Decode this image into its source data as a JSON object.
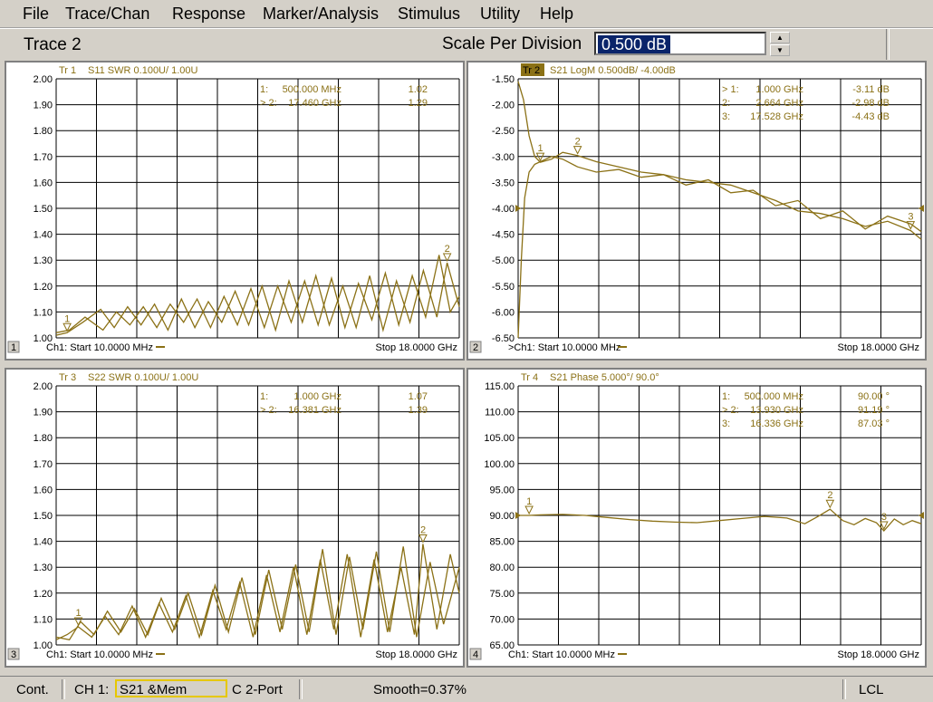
{
  "menu": [
    "File",
    "Trace/Chan",
    "Response",
    "Marker/Analysis",
    "Stimulus",
    "Utility",
    "Help"
  ],
  "toolbar": {
    "active_trace": "Trace 2",
    "scale_label": "Scale Per Division",
    "scale_value": "0.500 dB",
    "spin_up": "▲",
    "spin_down": "▼"
  },
  "colors": {
    "trace": "#8b7116",
    "grid": "#000000",
    "background": "#ffffff",
    "active_header_bg": "#8b7116"
  },
  "status": {
    "mode": "Cont.",
    "channel": "CH 1:",
    "trace_box": "S21 &Mem",
    "cal": "C  2-Port",
    "smooth": "Smooth=0.37%",
    "remote": "LCL"
  },
  "panels": [
    {
      "index": "1",
      "tr_label": "Tr  1",
      "header": "S11 SWR 0.100U/  1.00U",
      "active": false,
      "y_ticks": [
        "2.00",
        "1.90",
        "1.80",
        "1.70",
        "1.60",
        "1.50",
        "1.40",
        "1.30",
        "1.20",
        "1.10",
        "1.00"
      ],
      "start_label": "Ch1: Start  10.0000 MHz",
      "stop_label": "Stop  18.0000 GHz",
      "markers_table": [
        {
          "num": "1:",
          "freq": "500.000 MHz",
          "val": "1.02",
          "active": false
        },
        {
          "num": "> 2:",
          "freq": "17.460 GHz",
          "val": "1.29",
          "active": true
        }
      ]
    },
    {
      "index": "2",
      "tr_label": "Tr  2",
      "header": "S21 LogM 0.500dB/  -4.00dB",
      "active": true,
      "y_ticks": [
        "-1.50",
        "-2.00",
        "-2.50",
        "-3.00",
        "-3.50",
        "-4.00",
        "-4.50",
        "-5.00",
        "-5.50",
        "-6.00",
        "-6.50"
      ],
      "start_label": ">Ch1: Start  10.0000 MHz",
      "stop_label": "Stop  18.0000 GHz",
      "markers_table": [
        {
          "num": "> 1:",
          "freq": "1.000 GHz",
          "val": "-3.11 dB",
          "active": true
        },
        {
          "num": "2:",
          "freq": "2.664 GHz",
          "val": "-2.98 dB",
          "active": false
        },
        {
          "num": "3:",
          "freq": "17.528 GHz",
          "val": "-4.43 dB",
          "active": false
        }
      ]
    },
    {
      "index": "3",
      "tr_label": "Tr  3",
      "header": "S22 SWR 0.100U/  1.00U",
      "active": false,
      "y_ticks": [
        "2.00",
        "1.90",
        "1.80",
        "1.70",
        "1.60",
        "1.50",
        "1.40",
        "1.30",
        "1.20",
        "1.10",
        "1.00"
      ],
      "start_label": "Ch1: Start  10.0000 MHz",
      "stop_label": "Stop  18.0000 GHz",
      "markers_table": [
        {
          "num": "1:",
          "freq": "1.000 GHz",
          "val": "1.07",
          "active": false
        },
        {
          "num": "> 2:",
          "freq": "16.381 GHz",
          "val": "1.39",
          "active": true
        }
      ]
    },
    {
      "index": "4",
      "tr_label": "Tr  4",
      "header": "S21 Phase 5.000°/  90.0°",
      "active": false,
      "y_ticks": [
        "115.00",
        "110.00",
        "105.00",
        "100.00",
        "95.00",
        "90.00",
        "85.00",
        "80.00",
        "75.00",
        "70.00",
        "65.00"
      ],
      "start_label": "Ch1: Start  10.0000 MHz",
      "stop_label": "Stop  18.0000 GHz",
      "markers_table": [
        {
          "num": "1:",
          "freq": "500.000 MHz",
          "val": "90.00 °",
          "active": false
        },
        {
          "num": "> 2:",
          "freq": "13.930 GHz",
          "val": "91.19 °",
          "active": true
        },
        {
          "num": "3:",
          "freq": "16.336 GHz",
          "val": "87.03 °",
          "active": false
        }
      ]
    }
  ],
  "chart_data": [
    {
      "type": "line",
      "title": "S11 SWR 0.100U/  1.00U",
      "xlabel": "",
      "ylabel": "",
      "xlim_ghz": [
        0.01,
        18.0
      ],
      "ylim": [
        1.0,
        2.0
      ],
      "grid": true,
      "series": [
        {
          "x": [
            0.01,
            0.5,
            1.2,
            2.0,
            2.6,
            3.2,
            3.8,
            4.4,
            5.0,
            5.6,
            6.2,
            6.8,
            7.4,
            8.0,
            8.6,
            9.2,
            9.8,
            10.4,
            11.0,
            11.6,
            12.2,
            12.8,
            13.4,
            14.0,
            14.6,
            15.2,
            15.8,
            16.4,
            17.0,
            17.46,
            18.0
          ],
          "y": [
            1.01,
            1.02,
            1.06,
            1.11,
            1.04,
            1.12,
            1.05,
            1.13,
            1.03,
            1.15,
            1.04,
            1.14,
            1.06,
            1.18,
            1.05,
            1.2,
            1.03,
            1.22,
            1.06,
            1.24,
            1.05,
            1.2,
            1.04,
            1.24,
            1.03,
            1.22,
            1.06,
            1.26,
            1.08,
            1.29,
            1.12
          ]
        },
        {
          "x": [
            0.01,
            0.6,
            1.3,
            2.1,
            2.7,
            3.3,
            3.9,
            4.5,
            5.1,
            5.7,
            6.3,
            6.9,
            7.5,
            8.1,
            8.7,
            9.3,
            9.9,
            10.5,
            11.1,
            11.7,
            12.3,
            12.9,
            13.5,
            14.1,
            14.7,
            15.3,
            15.9,
            16.5,
            17.1,
            17.6,
            18.0
          ],
          "y": [
            1.02,
            1.03,
            1.08,
            1.03,
            1.1,
            1.05,
            1.12,
            1.04,
            1.13,
            1.06,
            1.15,
            1.04,
            1.16,
            1.05,
            1.19,
            1.04,
            1.2,
            1.06,
            1.22,
            1.05,
            1.23,
            1.04,
            1.21,
            1.07,
            1.25,
            1.05,
            1.24,
            1.08,
            1.32,
            1.1,
            1.16
          ]
        }
      ],
      "markers": [
        {
          "label": "1",
          "x": 0.5,
          "y": 1.02
        },
        {
          "label": "2",
          "x": 17.46,
          "y": 1.29
        }
      ]
    },
    {
      "type": "line",
      "title": "S21 LogM 0.500dB/  -4.00dB",
      "xlabel": "",
      "ylabel": "",
      "xlim_ghz": [
        0.01,
        18.0
      ],
      "ylim": [
        -6.5,
        -1.5
      ],
      "reference_level": -4.0,
      "grid": true,
      "series": [
        {
          "x": [
            0.01,
            0.25,
            0.5,
            0.75,
            1.0,
            1.5,
            2.0,
            2.66,
            3.5,
            4.5,
            5.5,
            6.5,
            7.5,
            8.5,
            9.5,
            10.5,
            11.5,
            12.5,
            13.5,
            14.5,
            15.5,
            16.5,
            17.53,
            18.0
          ],
          "y": [
            -1.55,
            -1.9,
            -2.6,
            -3.0,
            -3.11,
            -3.05,
            -2.92,
            -2.98,
            -3.1,
            -3.2,
            -3.3,
            -3.35,
            -3.45,
            -3.5,
            -3.55,
            -3.7,
            -3.85,
            -4.05,
            -4.1,
            -4.2,
            -4.35,
            -4.25,
            -4.43,
            -4.6
          ]
        },
        {
          "x": [
            0.01,
            0.15,
            0.3,
            0.5,
            0.75,
            1.0,
            1.5,
            2.0,
            2.66,
            3.5,
            4.5,
            5.5,
            6.5,
            7.5,
            8.5,
            9.5,
            10.5,
            11.5,
            12.5,
            13.5,
            14.5,
            15.5,
            16.5,
            17.53,
            18.0
          ],
          "y": [
            -6.5,
            -5.0,
            -3.8,
            -3.3,
            -3.15,
            -3.1,
            -3.0,
            -3.05,
            -3.2,
            -3.3,
            -3.25,
            -3.4,
            -3.35,
            -3.55,
            -3.45,
            -3.7,
            -3.65,
            -3.95,
            -3.85,
            -4.2,
            -4.05,
            -4.4,
            -4.15,
            -4.3,
            -4.45
          ]
        }
      ],
      "markers": [
        {
          "label": "1",
          "x": 1.0,
          "y": -3.11
        },
        {
          "label": "2",
          "x": 2.664,
          "y": -2.98
        },
        {
          "label": "3",
          "x": 17.528,
          "y": -4.43
        }
      ]
    },
    {
      "type": "line",
      "title": "S22 SWR 0.100U/  1.00U",
      "xlabel": "",
      "ylabel": "",
      "xlim_ghz": [
        0.01,
        18.0
      ],
      "ylim": [
        1.0,
        2.0
      ],
      "grid": true,
      "series": [
        {
          "x": [
            0.01,
            0.5,
            1.0,
            1.6,
            2.2,
            2.8,
            3.4,
            4.0,
            4.6,
            5.2,
            5.8,
            6.4,
            7.0,
            7.6,
            8.2,
            8.8,
            9.4,
            10.0,
            10.6,
            11.2,
            11.8,
            12.4,
            13.0,
            13.6,
            14.2,
            14.8,
            15.4,
            16.0,
            16.38,
            17.0,
            17.6,
            18.0
          ],
          "y": [
            1.02,
            1.04,
            1.07,
            1.03,
            1.11,
            1.04,
            1.15,
            1.03,
            1.16,
            1.05,
            1.19,
            1.03,
            1.21,
            1.06,
            1.24,
            1.03,
            1.27,
            1.05,
            1.3,
            1.04,
            1.33,
            1.06,
            1.35,
            1.03,
            1.33,
            1.05,
            1.3,
            1.04,
            1.39,
            1.06,
            1.35,
            1.2
          ]
        },
        {
          "x": [
            0.01,
            0.6,
            1.1,
            1.7,
            2.3,
            2.9,
            3.5,
            4.1,
            4.7,
            5.3,
            5.9,
            6.5,
            7.1,
            7.7,
            8.3,
            8.9,
            9.5,
            10.1,
            10.7,
            11.3,
            11.9,
            12.5,
            13.1,
            13.7,
            14.3,
            14.9,
            15.5,
            16.1,
            16.7,
            17.3,
            18.0
          ],
          "y": [
            1.03,
            1.02,
            1.09,
            1.04,
            1.13,
            1.05,
            1.14,
            1.04,
            1.18,
            1.06,
            1.2,
            1.04,
            1.23,
            1.05,
            1.26,
            1.04,
            1.29,
            1.06,
            1.31,
            1.05,
            1.37,
            1.04,
            1.34,
            1.06,
            1.36,
            1.05,
            1.38,
            1.03,
            1.32,
            1.08,
            1.3
          ]
        }
      ],
      "markers": [
        {
          "label": "1",
          "x": 1.0,
          "y": 1.07
        },
        {
          "label": "2",
          "x": 16.381,
          "y": 1.39
        }
      ]
    },
    {
      "type": "line",
      "title": "S21 Phase 5.000°/  90.0°",
      "xlabel": "",
      "ylabel": "",
      "xlim_ghz": [
        0.01,
        18.0
      ],
      "ylim": [
        65.0,
        115.0
      ],
      "reference_level": 90.0,
      "grid": true,
      "series": [
        {
          "x": [
            0.01,
            0.5,
            1.0,
            2.0,
            3.0,
            4.0,
            5.0,
            6.0,
            7.0,
            8.0,
            9.0,
            10.0,
            11.0,
            12.0,
            12.8,
            13.4,
            13.93,
            14.5,
            15.0,
            15.5,
            16.0,
            16.336,
            16.8,
            17.2,
            17.6,
            18.0
          ],
          "y": [
            90.0,
            90.0,
            90.1,
            90.2,
            90.0,
            89.6,
            89.2,
            88.9,
            88.7,
            88.6,
            89.0,
            89.4,
            89.8,
            89.5,
            88.4,
            89.8,
            91.19,
            89.0,
            88.2,
            89.4,
            88.6,
            87.03,
            89.3,
            88.2,
            89.0,
            88.4
          ]
        }
      ],
      "markers": [
        {
          "label": "1",
          "x": 0.5,
          "y": 90.0
        },
        {
          "label": "2",
          "x": 13.93,
          "y": 91.19
        },
        {
          "label": "3",
          "x": 16.336,
          "y": 87.03
        }
      ]
    }
  ]
}
